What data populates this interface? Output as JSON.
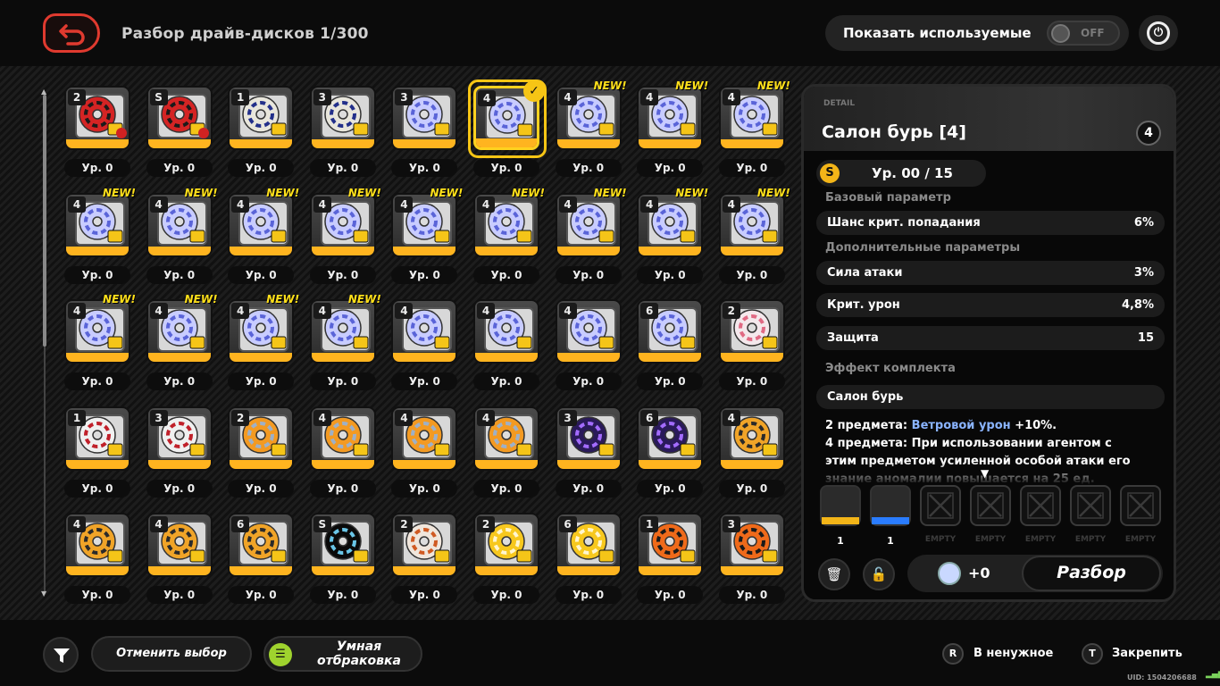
{
  "header": {
    "title": "Разбор драйв-дисков 1/300",
    "show_used_label": "Показать используемые",
    "toggle_state": "OFF"
  },
  "grid": {
    "items": [
      {
        "rank": "2",
        "level": "Ур. 0",
        "theme": "red",
        "new": false,
        "locked": true,
        "selected": false
      },
      {
        "rank": "S",
        "level": "Ур. 0",
        "theme": "red",
        "new": false,
        "locked": true,
        "selected": false
      },
      {
        "rank": "1",
        "level": "Ур. 0",
        "theme": "navy",
        "new": false,
        "locked": false,
        "selected": false
      },
      {
        "rank": "3",
        "level": "Ур. 0",
        "theme": "navy",
        "new": false,
        "locked": false,
        "selected": false
      },
      {
        "rank": "3",
        "level": "Ур. 0",
        "theme": "lav",
        "new": false,
        "locked": false,
        "selected": false
      },
      {
        "rank": "4",
        "level": "Ур. 0",
        "theme": "lav",
        "new": false,
        "locked": false,
        "selected": true
      },
      {
        "rank": "4",
        "level": "Ур. 0",
        "theme": "lav",
        "new": true,
        "locked": false,
        "selected": false
      },
      {
        "rank": "4",
        "level": "Ур. 0",
        "theme": "lav",
        "new": true,
        "locked": false,
        "selected": false
      },
      {
        "rank": "4",
        "level": "Ур. 0",
        "theme": "lav",
        "new": true,
        "locked": false,
        "selected": false
      },
      {
        "rank": "4",
        "level": "Ур. 0",
        "theme": "lav",
        "new": true,
        "locked": false,
        "selected": false
      },
      {
        "rank": "4",
        "level": "Ур. 0",
        "theme": "lav",
        "new": true,
        "locked": false,
        "selected": false
      },
      {
        "rank": "4",
        "level": "Ур. 0",
        "theme": "lav",
        "new": true,
        "locked": false,
        "selected": false
      },
      {
        "rank": "4",
        "level": "Ур. 0",
        "theme": "lav",
        "new": true,
        "locked": false,
        "selected": false
      },
      {
        "rank": "4",
        "level": "Ур. 0",
        "theme": "lav",
        "new": true,
        "locked": false,
        "selected": false
      },
      {
        "rank": "4",
        "level": "Ур. 0",
        "theme": "lav",
        "new": true,
        "locked": false,
        "selected": false
      },
      {
        "rank": "4",
        "level": "Ур. 0",
        "theme": "lav",
        "new": true,
        "locked": false,
        "selected": false
      },
      {
        "rank": "4",
        "level": "Ур. 0",
        "theme": "lav",
        "new": true,
        "locked": false,
        "selected": false
      },
      {
        "rank": "4",
        "level": "Ур. 0",
        "theme": "lav",
        "new": true,
        "locked": false,
        "selected": false
      },
      {
        "rank": "4",
        "level": "Ур. 0",
        "theme": "lav",
        "new": true,
        "locked": false,
        "selected": false
      },
      {
        "rank": "4",
        "level": "Ур. 0",
        "theme": "lav",
        "new": true,
        "locked": false,
        "selected": false
      },
      {
        "rank": "4",
        "level": "Ур. 0",
        "theme": "lav",
        "new": true,
        "locked": false,
        "selected": false
      },
      {
        "rank": "4",
        "level": "Ур. 0",
        "theme": "lav",
        "new": true,
        "locked": false,
        "selected": false
      },
      {
        "rank": "4",
        "level": "Ур. 0",
        "theme": "lav",
        "new": false,
        "locked": false,
        "selected": false
      },
      {
        "rank": "4",
        "level": "Ур. 0",
        "theme": "lav",
        "new": false,
        "locked": false,
        "selected": false
      },
      {
        "rank": "4",
        "level": "Ур. 0",
        "theme": "lav",
        "new": false,
        "locked": false,
        "selected": false
      },
      {
        "rank": "6",
        "level": "Ур. 0",
        "theme": "lav",
        "new": false,
        "locked": false,
        "selected": false
      },
      {
        "rank": "2",
        "level": "Ур. 0",
        "theme": "pink",
        "new": false,
        "locked": false,
        "selected": false
      },
      {
        "rank": "1",
        "level": "Ур. 0",
        "theme": "crimson",
        "new": false,
        "locked": false,
        "selected": false
      },
      {
        "rank": "3",
        "level": "Ур. 0",
        "theme": "crimson",
        "new": false,
        "locked": false,
        "selected": false
      },
      {
        "rank": "2",
        "level": "Ур. 0",
        "theme": "orange",
        "new": false,
        "locked": false,
        "selected": false
      },
      {
        "rank": "4",
        "level": "Ур. 0",
        "theme": "orange",
        "new": false,
        "locked": false,
        "selected": false
      },
      {
        "rank": "4",
        "level": "Ур. 0",
        "theme": "orange",
        "new": false,
        "locked": false,
        "selected": false
      },
      {
        "rank": "4",
        "level": "Ур. 0",
        "theme": "orange",
        "new": false,
        "locked": false,
        "selected": false
      },
      {
        "rank": "3",
        "level": "Ур. 0",
        "theme": "purple",
        "new": false,
        "locked": false,
        "selected": false
      },
      {
        "rank": "6",
        "level": "Ур. 0",
        "theme": "purple",
        "new": false,
        "locked": false,
        "selected": false
      },
      {
        "rank": "4",
        "level": "Ур. 0",
        "theme": "amber",
        "new": false,
        "locked": false,
        "selected": false
      },
      {
        "rank": "4",
        "level": "Ур. 0",
        "theme": "amber",
        "new": false,
        "locked": false,
        "selected": false
      },
      {
        "rank": "4",
        "level": "Ур. 0",
        "theme": "amber",
        "new": false,
        "locked": false,
        "selected": false
      },
      {
        "rank": "6",
        "level": "Ур. 0",
        "theme": "amber",
        "new": false,
        "locked": false,
        "selected": false
      },
      {
        "rank": "S",
        "level": "Ур. 0",
        "theme": "dark",
        "new": false,
        "locked": false,
        "selected": false
      },
      {
        "rank": "2",
        "level": "Ур. 0",
        "theme": "rust",
        "new": false,
        "locked": false,
        "selected": false
      },
      {
        "rank": "2",
        "level": "Ур. 0",
        "theme": "yellow",
        "new": false,
        "locked": false,
        "selected": false
      },
      {
        "rank": "6",
        "level": "Ур. 0",
        "theme": "yellow",
        "new": false,
        "locked": false,
        "selected": false
      },
      {
        "rank": "1",
        "level": "Ур. 0",
        "theme": "fire",
        "new": false,
        "locked": false,
        "selected": false
      },
      {
        "rank": "3",
        "level": "Ур. 0",
        "theme": "fire",
        "new": false,
        "locked": false,
        "selected": false
      }
    ],
    "new_label": "NEW!"
  },
  "themes": {
    "red": {
      "c1": "#d42424",
      "c2": "#1a1a1a"
    },
    "navy": {
      "c1": "#e8e6dc",
      "c2": "#23308a"
    },
    "lav": {
      "c1": "#c8ccff",
      "c2": "#5a64d8"
    },
    "pink": {
      "c1": "#f4e8ec",
      "c2": "#e06a84"
    },
    "crimson": {
      "c1": "#f0f0f0",
      "c2": "#c0202a"
    },
    "orange": {
      "c1": "#f39a22",
      "c2": "#9db0c8"
    },
    "purple": {
      "c1": "#2a1a5a",
      "c2": "#a36cff"
    },
    "amber": {
      "c1": "#f0a428",
      "c2": "#2a2a2a"
    },
    "dark": {
      "c1": "#0a0a0a",
      "c2": "#6ac6e8"
    },
    "rust": {
      "c1": "#f0e6dc",
      "c2": "#d05a22"
    },
    "yellow": {
      "c1": "#f7c81e",
      "c2": "#fff6d0"
    },
    "fire": {
      "c1": "#ef6a1a",
      "c2": "#1a1a1a"
    }
  },
  "detail": {
    "tag": "DETAIL",
    "title": "Салон бурь [4]",
    "rank": "4",
    "level": "Ур. 00 / 15",
    "coin": "S",
    "base_label": "Базовый параметр",
    "base_stat": {
      "name": "Шанс крит. попадания",
      "value": "6%"
    },
    "extra_label": "Дополнительные параметры",
    "extra_stats": [
      {
        "name": "Сила атаки",
        "value": "3%"
      },
      {
        "name": "Крит. урон",
        "value": "4,8%"
      },
      {
        "name": "Защита",
        "value": "15"
      }
    ],
    "set_label": "Эффект комплекта",
    "set_name": "Салон бурь",
    "set_desc": {
      "p2_prefix": "2 предмета:",
      "p2_highlight": "Ветровой урон",
      "p2_suffix": "+10%.",
      "p4_prefix": "4 предмета:",
      "p4_text": "При использовании агентом с этим предметом усиленной особой атаки его знание аномалии повышается на 25 ед."
    },
    "slots": {
      "filled": [
        {
          "count": "1",
          "color": "#f3b518"
        },
        {
          "count": "1",
          "color": "#2a7cff"
        }
      ],
      "empty_label": "EMPTY",
      "empty_count": 5
    },
    "gain": "+0",
    "dismantle": "Разбор",
    "trash_icon": "trash-icon",
    "lock_icon": "unlock-icon"
  },
  "footer": {
    "cancel": "Отменить выбор",
    "smart": "Умная отбраковка",
    "key_r": "R",
    "key_r_label": "В ненужное",
    "key_t": "T",
    "key_t_label": "Закрепить",
    "uid": "UID: 1504206688"
  }
}
